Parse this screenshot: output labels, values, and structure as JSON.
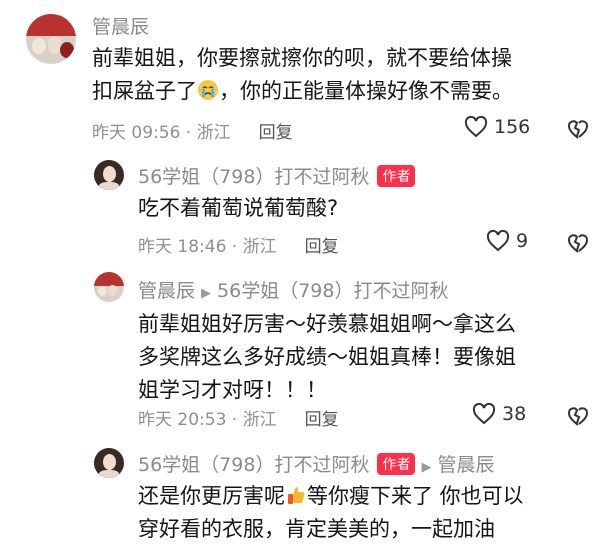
{
  "comments": [
    {
      "author": "管晨辰",
      "text_line1": "前辈姐姐，你要擦就擦你的呗，就不要给体操",
      "text_line2a": "扣屎盆子了",
      "text_line2b": "，你的正能量体操好像不需要。",
      "time": "昨天 09:56 · 浙江",
      "reply_label": "回复",
      "likes": "156"
    },
    {
      "author": "56学姐（798）打不过阿秋",
      "badge": "作者",
      "text": "吃不着葡萄说葡萄酸?",
      "time": "昨天 18:46 · 浙江",
      "reply_label": "回复",
      "likes": "9"
    },
    {
      "author": "管晨辰",
      "reply_to": "56学姐（798）打不过阿秋",
      "text_line1": "前辈姐姐好厉害～好羡慕姐姐啊～拿这么",
      "text_line2": "多奖牌这么多好成绩～姐姐真棒！要像姐",
      "text_line3": "姐学习才对呀！！！",
      "time": "昨天 20:53 · 浙江",
      "reply_label": "回复",
      "likes": "38"
    },
    {
      "author": "56学姐（798）打不过阿秋",
      "badge": "作者",
      "reply_to": "管晨辰",
      "text_line1a": "还是你更厉害呢",
      "text_line1b": "等你瘦下来了 你也可以",
      "text_line2": "穿好看的衣服，肯定美美的，一起加油"
    }
  ],
  "colors": {
    "badge": "#ff2e4d",
    "meta": "#8f8f8f",
    "text": "#151515"
  },
  "icons": [
    "heart-icon",
    "broken-heart-icon",
    "crying-emoji-icon",
    "thumbs-up-emoji-icon",
    "play-arrow-icon"
  ]
}
